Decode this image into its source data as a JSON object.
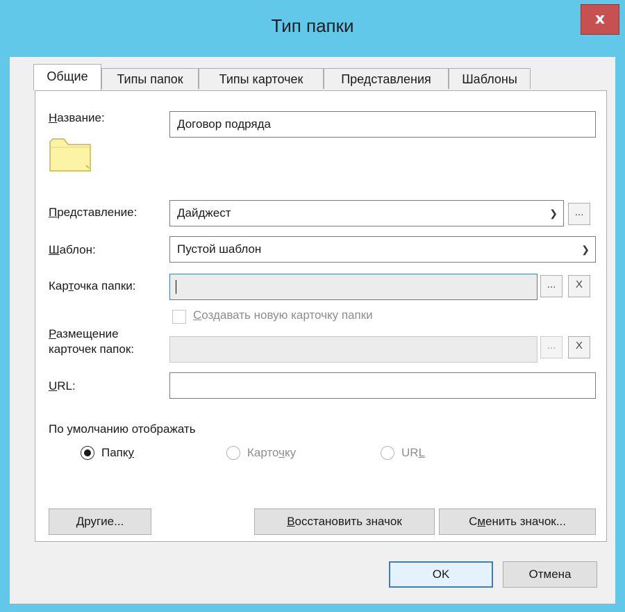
{
  "window": {
    "title": "Тип папки",
    "close_glyph": "x"
  },
  "tabs": [
    {
      "label": "Общие",
      "active": true
    },
    {
      "label": "Типы папок",
      "active": false
    },
    {
      "label": "Типы карточек",
      "active": false
    },
    {
      "label": "Представления",
      "active": false
    },
    {
      "label": "Шаблоны",
      "active": false
    }
  ],
  "form": {
    "name": {
      "label_first": "Н",
      "label_rest": "азвание:",
      "value": "Договор подряда"
    },
    "view": {
      "label_first": "П",
      "label_rest": "редставление:",
      "value": "Дайджест",
      "browse": "..."
    },
    "template": {
      "label_first": "Ш",
      "label_rest": "аблон:",
      "value": "Пустой шаблон"
    },
    "folder_card": {
      "label_a": "Кар",
      "label_u": "т",
      "label_b": "очка папки:",
      "value": "",
      "browse": "...",
      "clear": "X"
    },
    "create_new_card": {
      "label_u": "С",
      "label_rest": "оздавать новую карточку папки",
      "checked": false
    },
    "placement": {
      "label_line1_u": "Р",
      "label_line1_rest": "азмещение",
      "label_line2": "карточек папок:",
      "value": "",
      "browse": "...",
      "clear": "X"
    },
    "url": {
      "label_u": "U",
      "label_rest": "RL:",
      "value": ""
    }
  },
  "default_display": {
    "caption": "По умолчанию отображать",
    "options": [
      {
        "label_a": "Папк",
        "label_u": "у",
        "label_b": "",
        "selected": true,
        "enabled": true
      },
      {
        "label_a": "Карто",
        "label_u": "ч",
        "label_b": "ку",
        "selected": false,
        "enabled": false
      },
      {
        "label_a": "UR",
        "label_u": "L",
        "label_b": "",
        "selected": false,
        "enabled": false
      }
    ]
  },
  "panel_buttons": {
    "other": {
      "u": "Д",
      "rest": "ругие..."
    },
    "restore_icon": {
      "u": "В",
      "rest": "осстановить значок"
    },
    "change_icon": {
      "a": "С",
      "u": "м",
      "b": "енить значок..."
    }
  },
  "dialog_buttons": {
    "ok": "OK",
    "cancel": "Отмена"
  },
  "colors": {
    "title_bar": "#61c8ea",
    "close_button": "#c75050",
    "default_button_border": "#3c7fb1"
  },
  "icons": {
    "folder": "folder-icon",
    "close": "close-icon",
    "dropdown": "chevron-down-icon"
  }
}
